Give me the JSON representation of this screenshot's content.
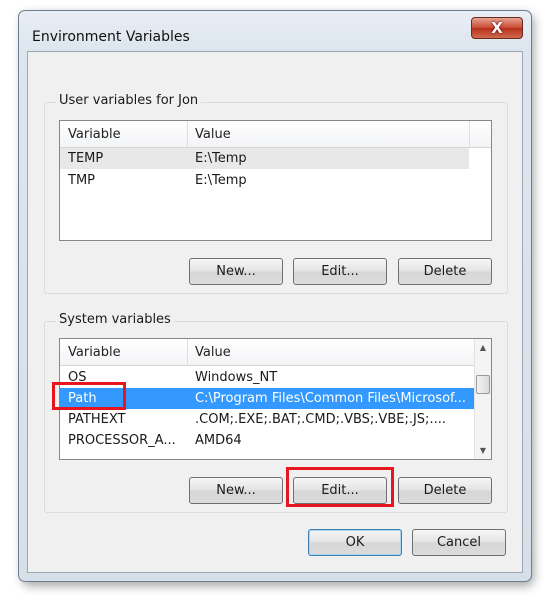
{
  "window": {
    "title": "Environment Variables",
    "close_glyph": "X"
  },
  "user_vars": {
    "group_label": "User variables for Jon",
    "columns": [
      "Variable",
      "Value"
    ],
    "rows": [
      {
        "variable": "TEMP",
        "value": "E:\\Temp"
      },
      {
        "variable": "TMP",
        "value": "E:\\Temp"
      }
    ],
    "buttons": {
      "new": "New...",
      "edit": "Edit...",
      "delete": "Delete"
    }
  },
  "system_vars": {
    "group_label": "System variables",
    "columns": [
      "Variable",
      "Value"
    ],
    "rows": [
      {
        "variable": "OS",
        "value": "Windows_NT"
      },
      {
        "variable": "Path",
        "value": "C:\\Program Files\\Common Files\\Microsof..."
      },
      {
        "variable": "PATHEXT",
        "value": ".COM;.EXE;.BAT;.CMD;.VBS;.VBE;.JS;...."
      },
      {
        "variable": "PROCESSOR_A...",
        "value": "AMD64"
      }
    ],
    "buttons": {
      "new": "New...",
      "edit": "Edit...",
      "delete": "Delete"
    }
  },
  "dialog_buttons": {
    "ok": "OK",
    "cancel": "Cancel"
  },
  "colors": {
    "selection": "#3399ff",
    "highlight": "#e8141e"
  }
}
